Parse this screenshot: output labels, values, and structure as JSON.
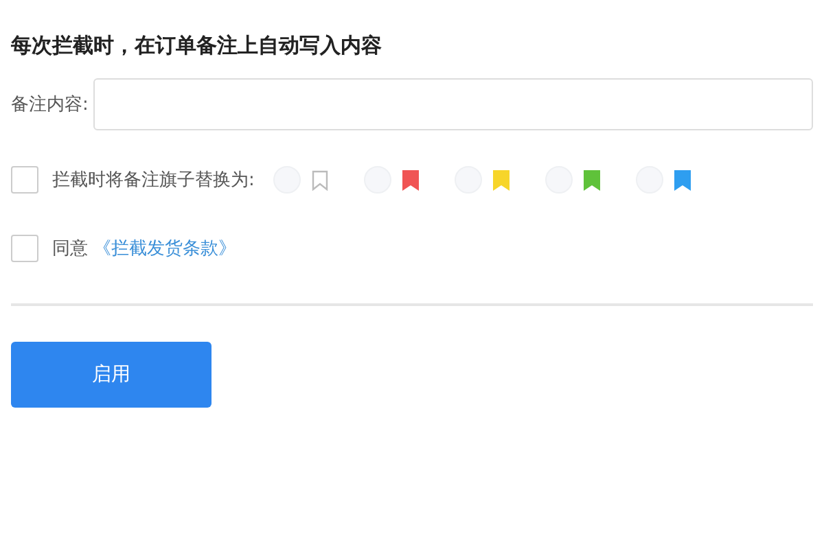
{
  "heading": "每次拦截时，在订单备注上自动写入内容",
  "note": {
    "label": "备注内容:"
  },
  "flag_option": {
    "label": "拦截时将备注旗子替换为:",
    "checked": false,
    "flags": [
      {
        "kind": "none",
        "selected": false
      },
      {
        "kind": "color",
        "color": "#f05454",
        "selected": false
      },
      {
        "kind": "color",
        "color": "#f7d52a",
        "selected": false
      },
      {
        "kind": "color",
        "color": "#5fc23a",
        "selected": false
      },
      {
        "kind": "color",
        "color": "#2e9ef0",
        "selected": false
      }
    ]
  },
  "agree": {
    "label": "同意",
    "link": "《拦截发货条款》",
    "checked": false
  },
  "button": "启用"
}
